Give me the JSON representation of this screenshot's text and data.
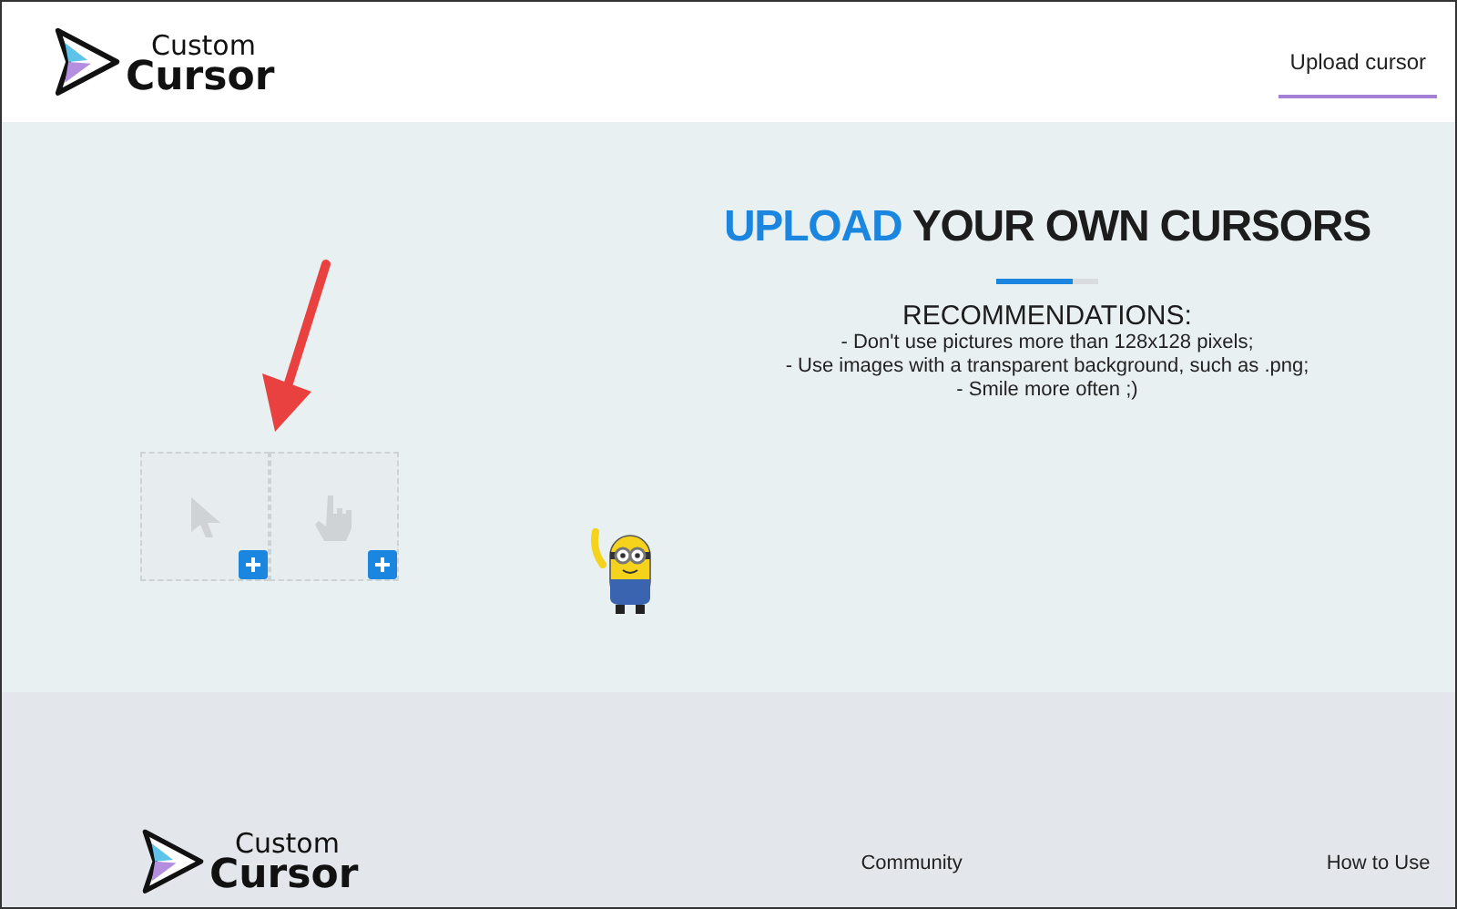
{
  "header": {
    "logo": {
      "line_1": "Custom",
      "line_2": "Cursor"
    },
    "nav": [
      {
        "label": "Upload cursor",
        "selected": true
      }
    ]
  },
  "upload": {
    "title_highlight": "UPLOAD",
    "title_rest": "YOUR OWN CURSORS",
    "recommendations_heading": "RECOMMENDATIONS:",
    "recommendations": [
      "- Don't use pictures more than 128x128 pixels;",
      "- Use images with a transparent background, such as .png;",
      "- Smile more often ;)"
    ],
    "slots": [
      {
        "kind": "arrow"
      },
      {
        "kind": "hand"
      }
    ]
  },
  "footer": {
    "logo": {
      "line_1": "Custom",
      "line_2": "Cursor"
    },
    "columns": [
      [
        "Community"
      ],
      [
        "How to Use"
      ]
    ]
  }
}
